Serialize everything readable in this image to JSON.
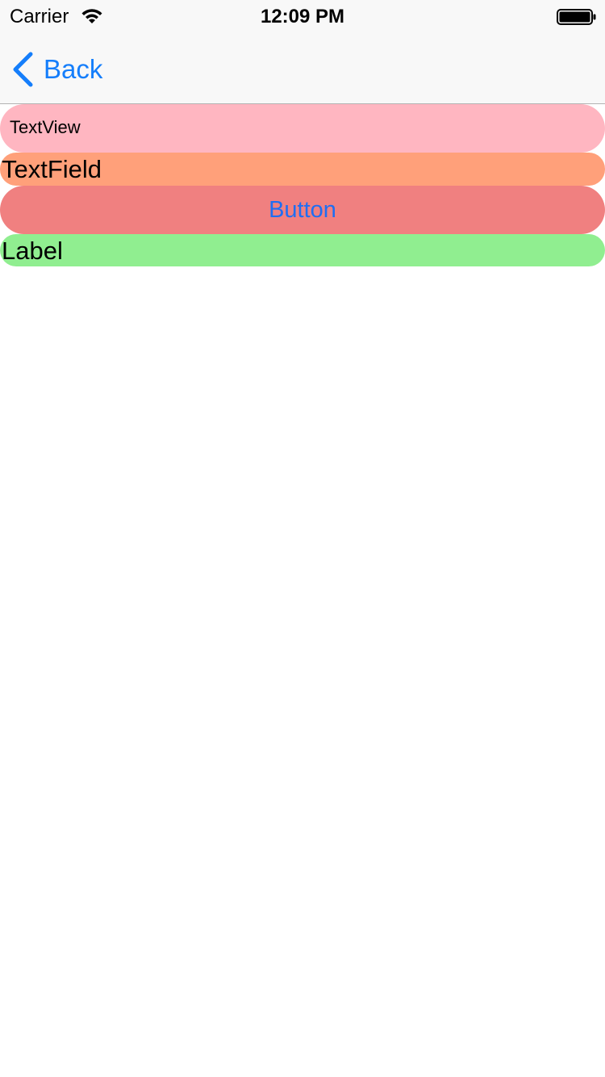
{
  "status_bar": {
    "carrier": "Carrier",
    "time": "12:09 PM",
    "wifi_icon": "wifi-icon",
    "battery_icon": "battery-icon"
  },
  "nav_bar": {
    "back_label": "Back",
    "back_icon": "chevron-left-icon"
  },
  "content": {
    "text_view_text": "TextView",
    "text_field_value": "TextField",
    "button_label": "Button",
    "label_text": "Label"
  },
  "colors": {
    "tint": "#157efb",
    "text_view_bg": "#ffb6c1",
    "text_field_bg": "#ffa07a",
    "button_bg": "#f08080",
    "label_bg": "#90ee90",
    "bar_bg": "#f8f8f8"
  }
}
